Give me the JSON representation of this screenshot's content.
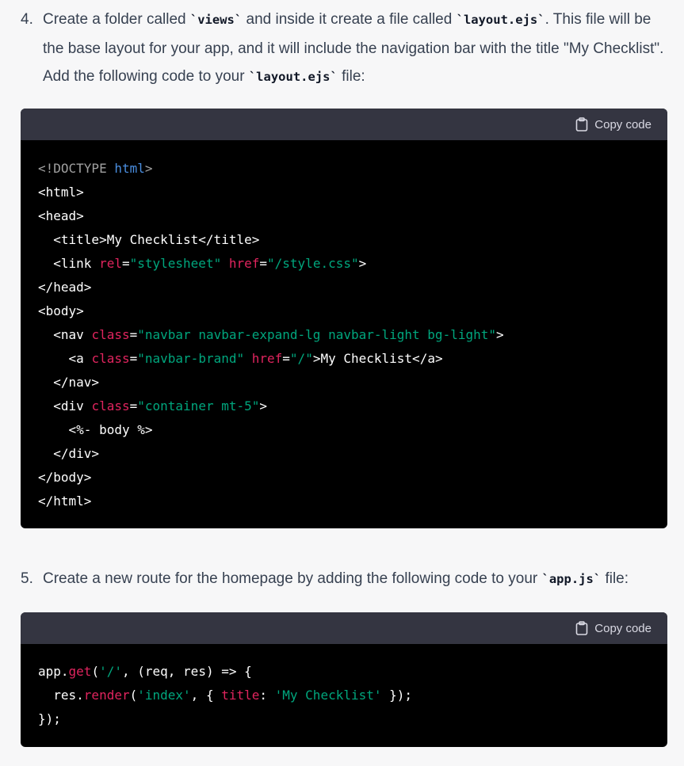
{
  "steps": [
    {
      "number": "4.",
      "segments": [
        {
          "t": "text",
          "v": "Create a folder called "
        },
        {
          "t": "code",
          "v": "`views`"
        },
        {
          "t": "text",
          "v": " and inside it create a file called "
        },
        {
          "t": "code",
          "v": "`layout.ejs`"
        },
        {
          "t": "text",
          "v": ". This file will be the base layout for your app, and it will include the navigation bar with the title \"My Checklist\". Add the following code to your "
        },
        {
          "t": "code",
          "v": "`layout.ejs`"
        },
        {
          "t": "text",
          "v": " file:"
        }
      ]
    },
    {
      "number": "5.",
      "segments": [
        {
          "t": "text",
          "v": "Create a new route for the homepage by adding the following code to your "
        },
        {
          "t": "code",
          "v": "`app.js`"
        },
        {
          "t": "text",
          "v": " file:"
        }
      ]
    }
  ],
  "copy_label": "Copy code",
  "code_blocks": [
    {
      "lines": [
        [
          [
            "g",
            "<!DOCTYPE "
          ],
          [
            "b",
            "html"
          ],
          [
            "g",
            ">"
          ]
        ],
        [
          [
            "w",
            "<html>"
          ]
        ],
        [
          [
            "w",
            "<head>"
          ]
        ],
        [
          [
            "w",
            "  <title>My Checklist</title>"
          ]
        ],
        [
          [
            "w",
            "  <link "
          ],
          [
            "r",
            "rel"
          ],
          [
            "w",
            "="
          ],
          [
            "s",
            "\"stylesheet\""
          ],
          [
            "w",
            " "
          ],
          [
            "r",
            "href"
          ],
          [
            "w",
            "="
          ],
          [
            "s",
            "\"/style.css\""
          ],
          [
            "w",
            ">"
          ]
        ],
        [
          [
            "w",
            "</head>"
          ]
        ],
        [
          [
            "w",
            "<body>"
          ]
        ],
        [
          [
            "w",
            "  <nav "
          ],
          [
            "r",
            "class"
          ],
          [
            "w",
            "="
          ],
          [
            "s",
            "\"navbar navbar-expand-lg navbar-light bg-light\""
          ],
          [
            "w",
            ">"
          ]
        ],
        [
          [
            "w",
            "    <a "
          ],
          [
            "r",
            "class"
          ],
          [
            "w",
            "="
          ],
          [
            "s",
            "\"navbar-brand\""
          ],
          [
            "w",
            " "
          ],
          [
            "r",
            "href"
          ],
          [
            "w",
            "="
          ],
          [
            "s",
            "\"/\""
          ],
          [
            "w",
            ">My Checklist</a>"
          ]
        ],
        [
          [
            "w",
            "  </nav>"
          ]
        ],
        [
          [
            "w",
            "  <div "
          ],
          [
            "r",
            "class"
          ],
          [
            "w",
            "="
          ],
          [
            "s",
            "\"container mt-5\""
          ],
          [
            "w",
            ">"
          ]
        ],
        [
          [
            "w",
            "    <%- body %>"
          ]
        ],
        [
          [
            "w",
            "  </div>"
          ]
        ],
        [
          [
            "w",
            "</body>"
          ]
        ],
        [
          [
            "w",
            "</html>"
          ]
        ]
      ]
    },
    {
      "lines": [
        [
          [
            "w",
            "app."
          ],
          [
            "r",
            "get"
          ],
          [
            "w",
            "("
          ],
          [
            "s",
            "'/'"
          ],
          [
            "w",
            ", (req, res) => {"
          ]
        ],
        [
          [
            "w",
            "  res."
          ],
          [
            "r",
            "render"
          ],
          [
            "w",
            "("
          ],
          [
            "s",
            "'index'"
          ],
          [
            "w",
            ", { "
          ],
          [
            "r",
            "title"
          ],
          [
            "w",
            ": "
          ],
          [
            "s",
            "'My Checklist'"
          ],
          [
            "w",
            " });"
          ]
        ],
        [
          [
            "w",
            "});"
          ]
        ]
      ]
    }
  ]
}
